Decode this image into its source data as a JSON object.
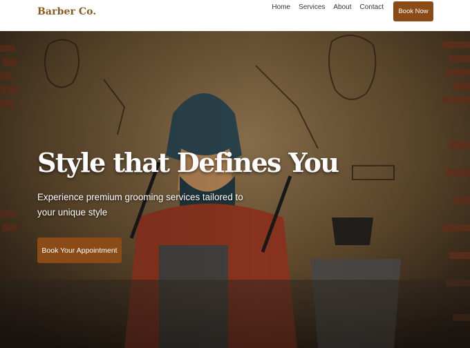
{
  "header": {
    "brand": "Barber Co.",
    "nav": [
      {
        "label": "Home"
      },
      {
        "label": "Services"
      },
      {
        "label": "About"
      },
      {
        "label": "Contact"
      }
    ],
    "book_now_label": "Book Now"
  },
  "hero": {
    "title": "Style that Defines You",
    "subtitle": "Experience premium grooming services tailored to your unique style",
    "cta_label": "Book Your Appointment",
    "image_description_name": "barber-mural-background"
  },
  "colors": {
    "brand": "#8a5a1f",
    "accent": "#8a4b16",
    "header_bg": "#ffffff",
    "nav_text": "#333333"
  }
}
